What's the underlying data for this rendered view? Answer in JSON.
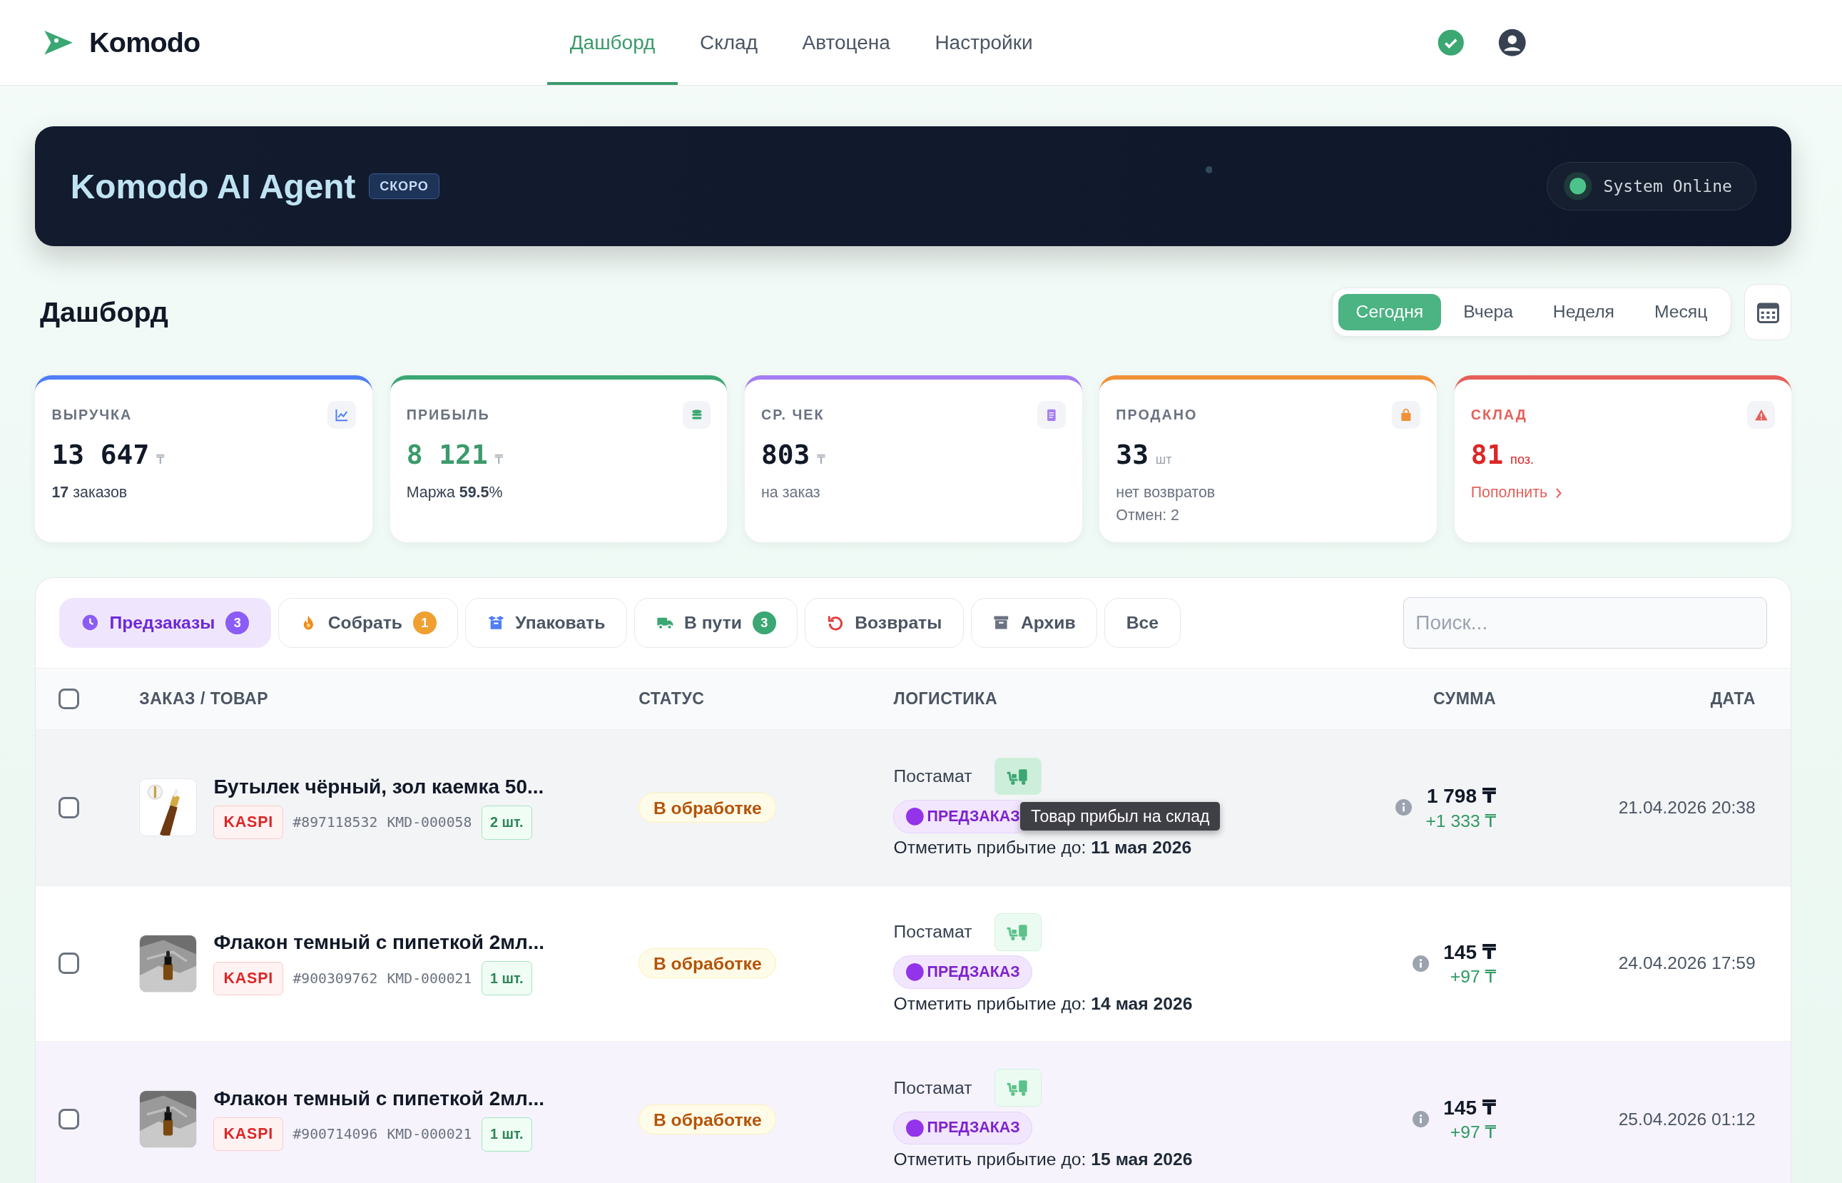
{
  "brand": {
    "name": "Komodo"
  },
  "nav": [
    {
      "label": "Дашборд",
      "selected": true
    },
    {
      "label": "Склад",
      "selected": false
    },
    {
      "label": "Автоцена",
      "selected": false
    },
    {
      "label": "Настройки",
      "selected": false
    }
  ],
  "banner": {
    "title": "Komodo AI Agent",
    "badge": "СКОРО",
    "status": "System Online"
  },
  "page_title": "Дашборд",
  "periods": [
    {
      "label": "Сегодня",
      "selected": true
    },
    {
      "label": "Вчера",
      "selected": false
    },
    {
      "label": "Неделя",
      "selected": false
    },
    {
      "label": "Месяц",
      "selected": false
    }
  ],
  "stats": [
    {
      "label": "ВЫРУЧКА",
      "value": "13 647",
      "unit": "₸",
      "color": "#4f7ef7",
      "kind": "revenue",
      "lines": [
        "**17** заказов"
      ]
    },
    {
      "label": "ПРИБЫЛЬ",
      "value": "8 121",
      "unit": "₸",
      "color": "#3ba773",
      "kind": "profit",
      "lines": [
        "Маржа **59.5**%"
      ]
    },
    {
      "label": "СР. ЧЕК",
      "value": "803",
      "unit": "₸",
      "color": "#a47cf3",
      "kind": "average",
      "lines": [
        "на заказ"
      ]
    },
    {
      "label": "ПРОДАНО",
      "value": "33",
      "unit": "шт",
      "color": "#f0913a",
      "kind": "sold",
      "lines": [
        "нет возвратов",
        "Отмен: 2"
      ]
    },
    {
      "label": "СКЛАД",
      "value": "81",
      "unit": "поз.",
      "color": "#e5605a",
      "kind": "stock",
      "link": "Пополнить"
    }
  ],
  "filters": [
    {
      "label": "Предзаказы",
      "count": "3",
      "color": "#8b5cf6",
      "kind": "preorders",
      "selected": true
    },
    {
      "label": "Собрать",
      "count": "1",
      "color": "#f0a030",
      "kind": "collect",
      "selected": false
    },
    {
      "label": "Упаковать",
      "kind": "pack",
      "selected": false
    },
    {
      "label": "В пути",
      "count": "3",
      "color": "#3ba773",
      "kind": "transit",
      "selected": false
    },
    {
      "label": "Возвраты",
      "kind": "returns",
      "selected": false
    },
    {
      "label": "Архив",
      "kind": "archive",
      "selected": false
    },
    {
      "label": "Все",
      "kind": "all",
      "selected": false
    }
  ],
  "search": {
    "placeholder": "Поиск..."
  },
  "table": {
    "select_all": {
      "checked": false
    },
    "columns": [
      "ЗАКАЗ / ТОВАР",
      "СТАТУС",
      "ЛОГИСТИКА",
      "СУММА",
      "ДАТА"
    ],
    "rows": [
      {
        "hovered": true,
        "highlighted": false,
        "checked": false,
        "title": "Бутылек чёрный, зол каемка 50...",
        "marketplace": "KASPI",
        "order": "#897118532",
        "sku": "KMD-000058",
        "qty": "2 шт.",
        "status": "В обработке",
        "delivery": "Постамат",
        "badge": "ПРЕДЗАКАЗ",
        "tooltip": "Товар прибыл на склад",
        "deadline": "Отметить прибытие до: **11 мая 2026**",
        "sum": "1 798 ₸",
        "profit": "+1 333 ₸",
        "date": "21.04.2026 20:38"
      },
      {
        "hovered": false,
        "highlighted": false,
        "checked": false,
        "title": "Флакон темный с пипеткой 2мл...",
        "marketplace": "KASPI",
        "order": "#900309762",
        "sku": "KMD-000021",
        "qty": "1 шт.",
        "status": "В обработке",
        "delivery": "Постамат",
        "badge": "ПРЕДЗАКАЗ",
        "deadline": "Отметить прибытие до: **14 мая 2026**",
        "sum": "145 ₸",
        "profit": "+97 ₸",
        "date": "24.04.2026 17:59"
      },
      {
        "hovered": false,
        "highlighted": true,
        "checked": false,
        "title": "Флакон темный с пипеткой 2мл...",
        "marketplace": "KASPI",
        "order": "#900714096",
        "sku": "KMD-000021",
        "qty": "1 шт.",
        "status": "В обработке",
        "delivery": "Постамат",
        "badge": "ПРЕДЗАКАЗ",
        "deadline": "Отметить прибытие до: **15 мая 2026**",
        "sum": "145 ₸",
        "profit": "+97 ₸",
        "date": "25.04.2026 01:12"
      }
    ]
  }
}
